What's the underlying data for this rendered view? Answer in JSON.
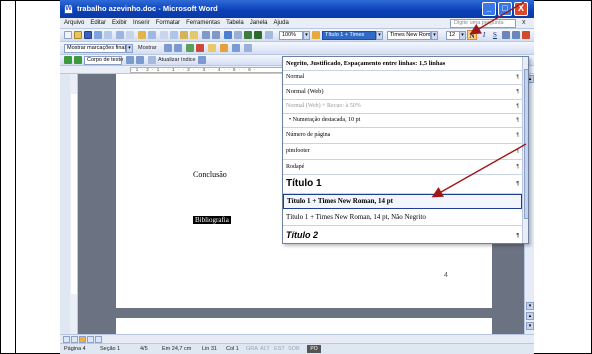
{
  "window": {
    "title": "trabalho azevinho.doc - Microsoft Word",
    "buttons": {
      "minimize": "_",
      "maximize": "□",
      "close": "X"
    }
  },
  "menu": {
    "items": [
      "Arquivo",
      "Editar",
      "Exibir",
      "Inserir",
      "Formatar",
      "Ferramentas",
      "Tabela",
      "Janela",
      "Ajuda"
    ],
    "help_placeholder": "Digite uma pergunta",
    "close": "x"
  },
  "toolbar": {
    "zoom": "100%",
    "style_value": "Título 1 + Times",
    "font_value": "Times New Roman",
    "size_value": "12",
    "format_buttons": [
      "N",
      "I",
      "S"
    ]
  },
  "toolbar2": {
    "show_markup": "Mostrar marcações finais",
    "show": "Mostrar",
    "arrow": "▾"
  },
  "toolbar3": {
    "textbox": "Corpo de texto",
    "update_index": "Atualizar índice"
  },
  "ruler": {
    "ticks": "· 1 · 2 · 1 · · 1 · · 2 · · 3 · · 4 · · 5 · · 6 ·"
  },
  "document": {
    "conclusao": "Conclusão",
    "bibliografia": "Bibliografia",
    "page_number_mark": "4"
  },
  "style_list": {
    "items": [
      {
        "label": "Negrito, Justificado, Espaçamento entre linhas:  1,5 linhas",
        "style": "bold-serif"
      },
      {
        "label": "Normal",
        "style": "small-serif"
      },
      {
        "label": "Normal (Web)",
        "style": "small-serif"
      },
      {
        "label": "Normal (Web) + Recuo: à 50%",
        "style": "dim-serif"
      },
      {
        "label": "•  Numeração destacada, 10 pt",
        "style": "small-serif"
      },
      {
        "label": "Número de página",
        "style": "small-serif"
      },
      {
        "label": "pimfooter",
        "style": "small-serif"
      },
      {
        "label": "Rodapé",
        "style": "small-serif"
      },
      {
        "label": "Título 1",
        "style": "heading1"
      },
      {
        "label": "Título 1 + Times New Roman, 14 pt",
        "style": "selected"
      },
      {
        "label": "Título 1 + Times New Roman, 14 pt, Não Negrito",
        "style": "normal14"
      },
      {
        "label": "Título 2",
        "style": "heading2"
      }
    ],
    "paragraph_mark": "¶"
  },
  "status": {
    "page": "Página 4",
    "section": "Seção 1",
    "pages": "4/5",
    "position": "Em 24,7 cm",
    "line": "Lin 31",
    "col": "Col 1",
    "gra": "GRA",
    "alt": "ALT",
    "est": "EST",
    "sob": "SOB",
    "lang": "PO"
  },
  "colors": {
    "titlebar": "#0a3fb5",
    "selection": "#316ac5",
    "annotation_arrow": "#a01818",
    "doc_background": "#6b7282"
  }
}
